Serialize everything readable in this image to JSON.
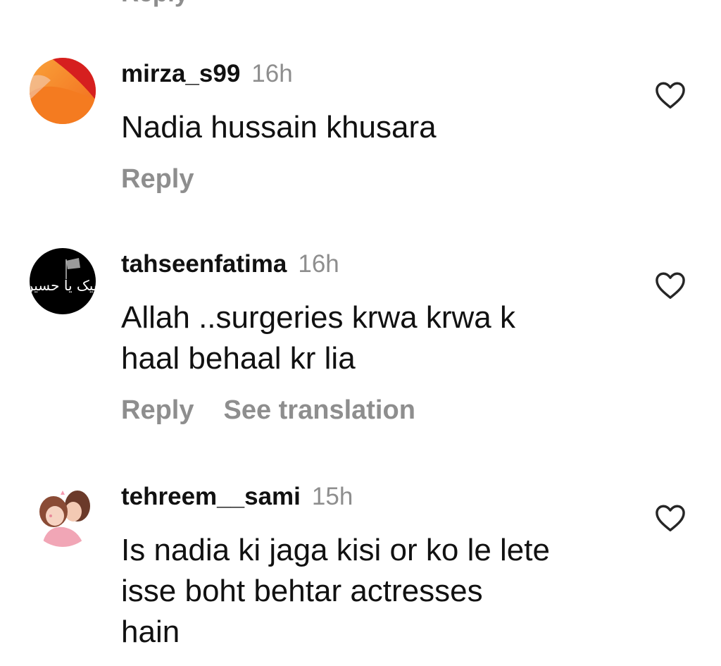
{
  "previous_comment": {
    "reply_label": "Reply"
  },
  "comments": [
    {
      "username": "mirza_s99",
      "time": "16h",
      "text": "Nadia hussain khusara",
      "reply_label": "Reply",
      "like_icon": "heart-outline-icon",
      "avatar": "orange-red-gradient-avatar"
    },
    {
      "username": "tahseenfatima",
      "time": "16h",
      "text": "Allah ..surgeries krwa krwa k\nhaal behaal kr lia",
      "reply_label": "Reply",
      "translation_label": "See translation",
      "like_icon": "heart-outline-icon",
      "avatar": "black-calligraphy-avatar",
      "avatar_text": "لبیک یا حسین"
    },
    {
      "username": "tehreem__sami",
      "time": "15h",
      "text": "Is nadia ki jaga kisi or ko le lete\nisse boht behtar actresses\nhain",
      "like_icon": "heart-outline-icon",
      "avatar": "illustrated-girls-avatar"
    }
  ],
  "colors": {
    "primary_text": "#111111",
    "secondary_text": "#8e8e8e",
    "background": "#ffffff"
  }
}
